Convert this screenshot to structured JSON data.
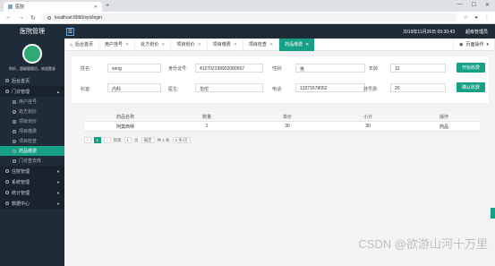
{
  "browser": {
    "tab_title": "医院",
    "url": "localhost:8090/sys/login"
  },
  "header": {
    "brand": "医院管理",
    "time": "2019年11月26日 09:30:43",
    "admin": "超级管理员"
  },
  "sidebar": {
    "greeting": "你好，超级管理员，欢迎登录",
    "items": [
      {
        "label": "后台首页",
        "type": "sec"
      },
      {
        "label": "门诊管理",
        "type": "sec"
      },
      {
        "label": "用户挂号",
        "type": "sub"
      },
      {
        "label": "处方划价",
        "type": "sub"
      },
      {
        "label": "项目划价",
        "type": "sub"
      },
      {
        "label": "项目缴费",
        "type": "sub"
      },
      {
        "label": "项目检查",
        "type": "sub"
      },
      {
        "label": "药品缴费",
        "type": "sub",
        "active": true
      },
      {
        "label": "门诊查去库",
        "type": "sub"
      },
      {
        "label": "住院管理",
        "type": "sec"
      },
      {
        "label": "系统管理",
        "type": "sec"
      },
      {
        "label": "统计管理",
        "type": "sec"
      },
      {
        "label": "数据中心",
        "type": "sec"
      }
    ]
  },
  "tabs": [
    "后台首页",
    "用户挂号",
    "处方划价",
    "项目划价",
    "项目缴费",
    "项目检查",
    "药品缴费"
  ],
  "tab_ops": "页面操作",
  "form": {
    "name_l": "姓名:",
    "name_v": "song",
    "id_l": "身份证号:",
    "id_v": "412702199902080557",
    "sex_l": "性别:",
    "sex_v": "男",
    "age_l": "年龄:",
    "age_v": "12",
    "dept_l": "科室:",
    "dept_v": "内科",
    "doc_l": "医生:",
    "doc_v": "华佗",
    "tel_l": "电话:",
    "tel_v": "13271678052",
    "reg_l": "挂号费:",
    "reg_v": "20",
    "btn_settle": "开始收费",
    "btn_confirm": "确认收费"
  },
  "table": {
    "headers": [
      "药品名称",
      "数量",
      "单价",
      "小计",
      "操作"
    ],
    "rows": [
      [
        "阿莫西林",
        "1",
        "30",
        "30",
        "药品"
      ]
    ]
  },
  "pager": {
    "prev": "‹",
    "cur": "1",
    "next": "›",
    "goto": "到第",
    "page": "1",
    "unit": "页",
    "ok": "确定",
    "total": "共 1 条",
    "size": "5 条/页"
  },
  "watermark": "CSDN @欲游山河十万里"
}
